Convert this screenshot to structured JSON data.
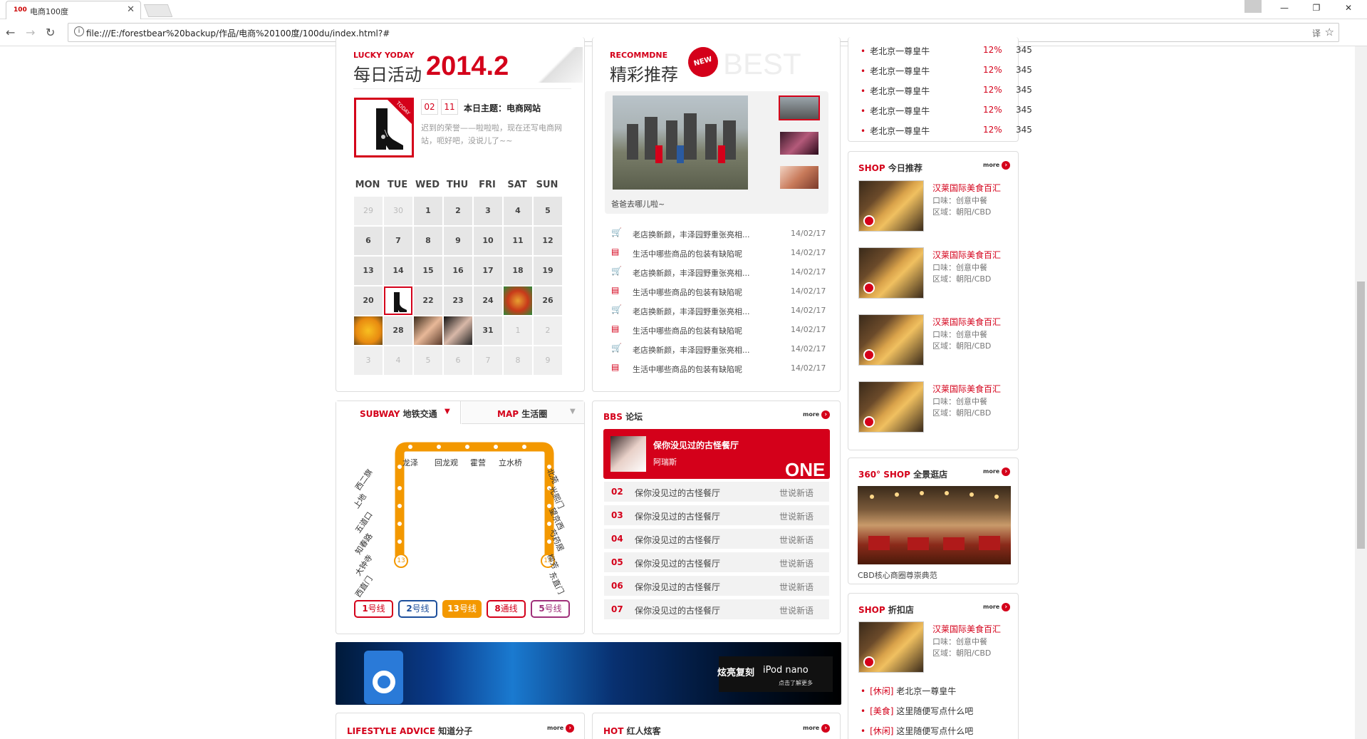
{
  "browser": {
    "tab_favicon": "100",
    "tab_title": "电商100度",
    "url": "file:///E:/forestbear%20backup/作品/电商%20100度/100du/index.html?#"
  },
  "lucky": {
    "small_title": "LUCKY YODAY",
    "title": "每日活动",
    "year": "2014.2",
    "today_badge": "TODAY",
    "month": "02",
    "day": "11",
    "theme": "本日主题：电商网站",
    "desc": "迟到的荣誉——啦啦啦，现在还写电商网站，呃好吧，没说儿了~~",
    "weekdays": [
      "MON",
      "TUE",
      "WED",
      "THU",
      "FRI",
      "SAT",
      "SUN"
    ],
    "days": [
      "29",
      "30",
      "1",
      "2",
      "3",
      "4",
      "5",
      "6",
      "7",
      "8",
      "9",
      "10",
      "11",
      "12",
      "13",
      "14",
      "15",
      "16",
      "17",
      "18",
      "19",
      "20",
      "",
      "22",
      "23",
      "24",
      "",
      "26",
      "",
      "28",
      "",
      "",
      "31",
      "1",
      "2",
      "3",
      "4",
      "5",
      "6",
      "7",
      "8",
      "9"
    ]
  },
  "recommend": {
    "small_title": "RECOMMDNE",
    "title": "精彩推荐",
    "new_badge": "NEW",
    "best": "BEST",
    "caption": "爸爸去哪儿啦~",
    "news": [
      {
        "type": "cart",
        "text": "老店换新颜，丰泽园野重张亮相...",
        "date": "14/02/17"
      },
      {
        "type": "doc",
        "text": "生活中哪些商品的包装有缺陷呢",
        "date": "14/02/17"
      },
      {
        "type": "cart",
        "text": "老店换新颜，丰泽园野重张亮相...",
        "date": "14/02/17"
      },
      {
        "type": "doc",
        "text": "生活中哪些商品的包装有缺陷呢",
        "date": "14/02/17"
      },
      {
        "type": "cart",
        "text": "老店换新颜，丰泽园野重张亮相...",
        "date": "14/02/17"
      },
      {
        "type": "doc",
        "text": "生活中哪些商品的包装有缺陷呢",
        "date": "14/02/17"
      },
      {
        "type": "cart",
        "text": "老店换新颜，丰泽园野重张亮相...",
        "date": "14/02/17"
      },
      {
        "type": "doc",
        "text": "生活中哪些商品的包装有缺陷呢",
        "date": "14/02/17"
      }
    ]
  },
  "subway": {
    "tab1_en": "SUBWAY",
    "tab1_cn": "地铁交通",
    "tab2_en": "MAP",
    "tab2_cn": "生活圈",
    "top_stations": [
      "龙泽",
      "回龙观",
      "霍营",
      "立水桥"
    ],
    "left_stations": [
      "西二旗",
      "上地",
      "五道口",
      "知春路",
      "大钟寺",
      "西直门"
    ],
    "right_stations": [
      "北苑",
      "光熙门",
      "望京西",
      "芍药居",
      "柳芳",
      "东直门"
    ],
    "badge": "13",
    "lines": [
      {
        "num": "1",
        "label": "号线",
        "color": "#d4001a"
      },
      {
        "num": "2",
        "label": "号线",
        "color": "#1d4f9c"
      },
      {
        "num": "13",
        "label": "号线",
        "color": "#f39800"
      },
      {
        "num": "8",
        "label": "通线",
        "color": "#d4001a"
      },
      {
        "num": "5",
        "label": "号线",
        "color": "#a0307a"
      }
    ]
  },
  "bbs": {
    "title_en": "BBS",
    "title_cn": "论坛",
    "more": "more",
    "top_title": "保你没见过的古怪餐厅",
    "top_author": "阿瑞斯",
    "top_rank": "ONE",
    "rows": [
      {
        "n": "02",
        "t": "保你没见过的古怪餐厅",
        "c": "世说新语"
      },
      {
        "n": "03",
        "t": "保你没见过的古怪餐厅",
        "c": "世说新语"
      },
      {
        "n": "04",
        "t": "保你没见过的古怪餐厅",
        "c": "世说新语"
      },
      {
        "n": "05",
        "t": "保你没见过的古怪餐厅",
        "c": "世说新语"
      },
      {
        "n": "06",
        "t": "保你没见过的古怪餐厅",
        "c": "世说新语"
      },
      {
        "n": "07",
        "t": "保你没见过的古怪餐厅",
        "c": "世说新语"
      }
    ]
  },
  "banner": {
    "text": "炫亮复刻",
    "brand": "iPod nano",
    "sub": "点击了解更多"
  },
  "bottom": {
    "lifestyle_en": "LIFESTYLE ADVICE",
    "lifestyle_cn": "知道分子",
    "hot_en": "HOT",
    "hot_cn": "红人炫客",
    "more": "more"
  },
  "right": {
    "top_list": [
      {
        "t": "老北京一尊皇牛",
        "p": "12%",
        "q": "345"
      },
      {
        "t": "老北京一尊皇牛",
        "p": "12%",
        "q": "345"
      },
      {
        "t": "老北京一尊皇牛",
        "p": "12%",
        "q": "345"
      },
      {
        "t": "老北京一尊皇牛",
        "p": "12%",
        "q": "345"
      },
      {
        "t": "老北京一尊皇牛",
        "p": "12%",
        "q": "345"
      }
    ],
    "shop_today_en": "SHOP",
    "shop_today_cn": "今日推荐",
    "shops": [
      {
        "name": "汉莱国际美食百汇",
        "l1": "口味：创意中餐",
        "l2": "区域：朝阳/CBD"
      },
      {
        "name": "汉莱国际美食百汇",
        "l1": "口味：创意中餐",
        "l2": "区域：朝阳/CBD"
      },
      {
        "name": "汉莱国际美食百汇",
        "l1": "口味：创意中餐",
        "l2": "区域：朝阳/CBD"
      },
      {
        "name": "汉莱国际美食百汇",
        "l1": "口味：创意中餐",
        "l2": "区域：朝阳/CBD"
      }
    ],
    "pano_en": "360° SHOP",
    "pano_cn": "全景逛店",
    "pano_caption": "CBD核心商圈尊崇典范",
    "discount_en": "SHOP",
    "discount_cn": "折扣店",
    "discount_shop": {
      "name": "汉莱国际美食百汇",
      "l1": "口味：创意中餐",
      "l2": "区域：朝阳/CBD"
    },
    "discount_list": [
      {
        "tag": "[休闲]",
        "t": "老北京一尊皇牛"
      },
      {
        "tag": "[美食]",
        "t": "这里随便写点什么吧"
      },
      {
        "tag": "[休闲]",
        "t": "这里随便写点什么吧"
      }
    ],
    "more": "more"
  }
}
